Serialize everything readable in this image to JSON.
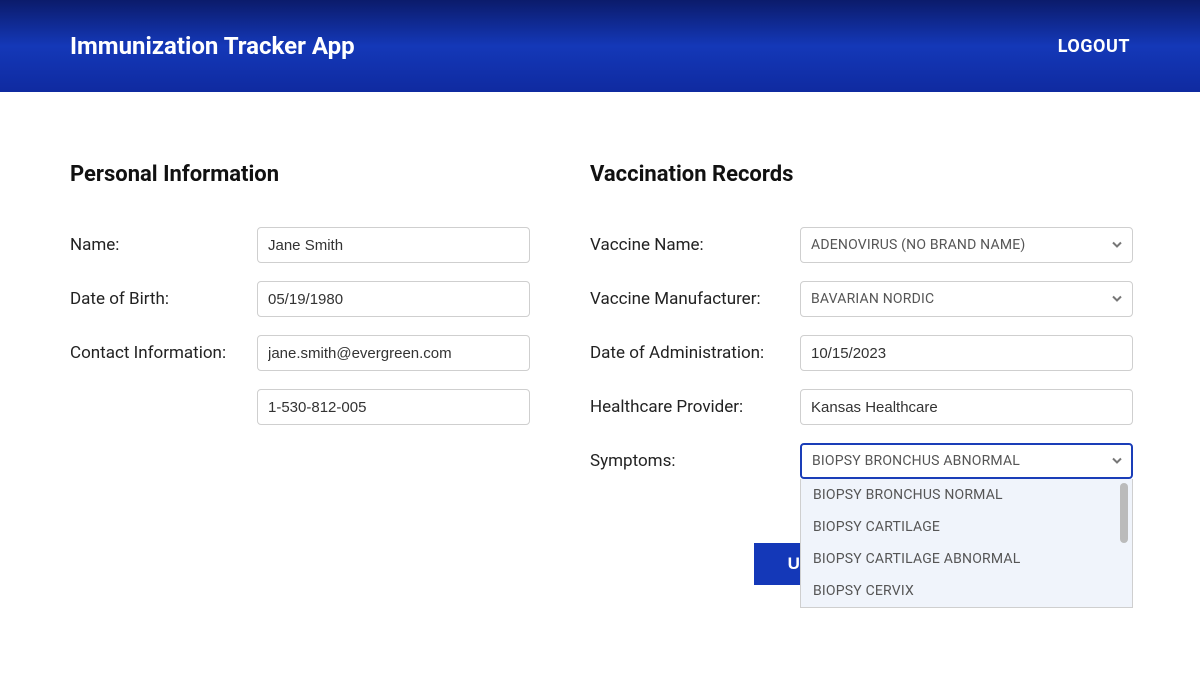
{
  "header": {
    "title": "Immunization Tracker App",
    "logout": "LOGOUT"
  },
  "personal": {
    "section_title": "Personal Information",
    "name_label": "Name:",
    "name_value": "Jane Smith",
    "dob_label": "Date of Birth:",
    "dob_value": "05/19/1980",
    "contact_label": "Contact Information:",
    "email_value": "jane.smith@evergreen.com",
    "phone_value": "1-530-812-005"
  },
  "vaccination": {
    "section_title": "Vaccination Records",
    "vaccine_name_label": "Vaccine Name:",
    "vaccine_name_value": "ADENOVIRUS (NO BRAND NAME)",
    "manufacturer_label": "Vaccine Manufacturer:",
    "manufacturer_value": "BAVARIAN NORDIC",
    "admin_date_label": "Date of Administration:",
    "admin_date_value": "10/15/2023",
    "provider_label": "Healthcare Provider:",
    "provider_value": "Kansas Healthcare",
    "symptoms_label": "Symptoms:",
    "symptoms_value": "BIOPSY BRONCHUS ABNORMAL",
    "symptoms_options": [
      "BIOPSY BRONCHUS NORMAL",
      "BIOPSY CARTILAGE",
      "BIOPSY CARTILAGE ABNORMAL",
      "BIOPSY CERVIX"
    ]
  },
  "actions": {
    "update": "UPDATE"
  }
}
